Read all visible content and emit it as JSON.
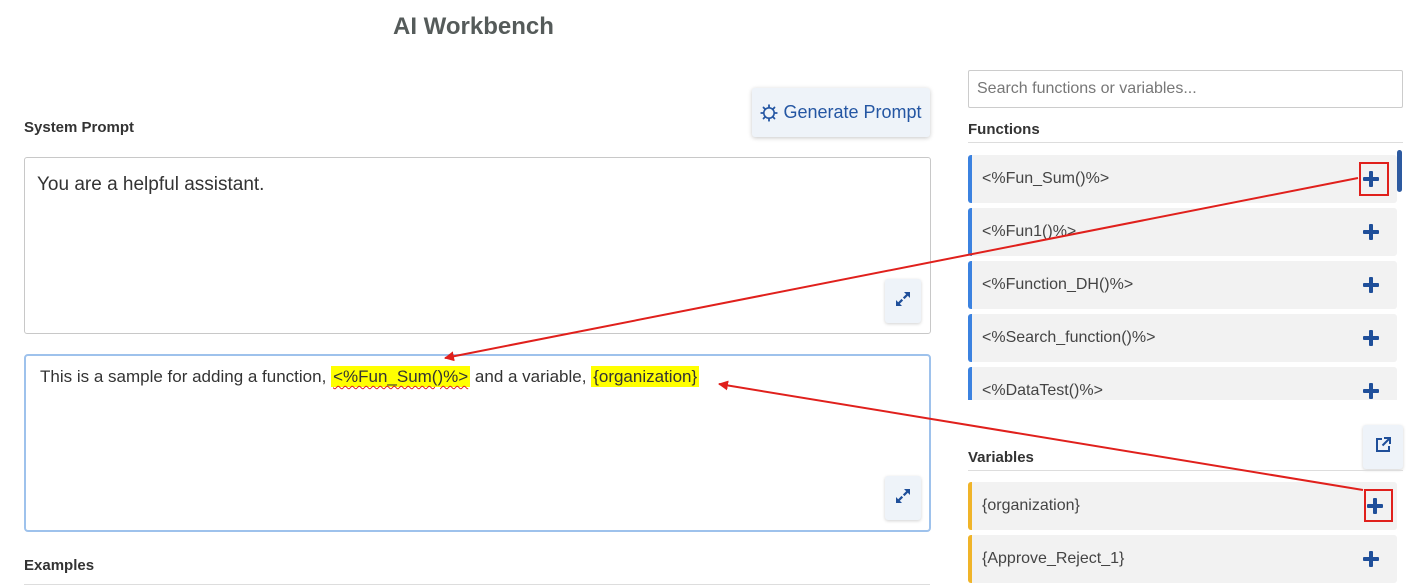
{
  "app": {
    "title": "AI Workbench"
  },
  "toolbar": {
    "generate_label": "Generate Prompt"
  },
  "system_prompt": {
    "label": "System Prompt",
    "value": "You are a helpful assistant."
  },
  "user_prompt": {
    "text_before": "This is a sample for adding a function,",
    "function_token": "<%Fun_Sum()%>",
    "text_middle": "and a variable,",
    "variable_token": "{organization}"
  },
  "examples": {
    "label": "Examples"
  },
  "sidebar": {
    "search_placeholder": "Search functions or variables...",
    "functions_heading": "Functions",
    "functions": [
      {
        "label": "<%Fun_Sum()%>"
      },
      {
        "label": "<%Fun1()%>"
      },
      {
        "label": "<%Function_DH()%>"
      },
      {
        "label": "<%Search_function()%>"
      },
      {
        "label": "<%DataTest()%>"
      }
    ],
    "variables_heading": "Variables",
    "variables": [
      {
        "label": "{organization}"
      },
      {
        "label": "{Approve_Reject_1}"
      }
    ]
  },
  "colors": {
    "accent": "#2456a3",
    "function_border": "#3b82e0",
    "variable_border": "#f0b429",
    "highlight": "#ffff00",
    "annotation_red": "#e0201c"
  },
  "icons": {
    "generate": "gear-icon",
    "expand": "expand-arrows-icon",
    "add": "plus-icon",
    "external": "external-link-icon"
  }
}
